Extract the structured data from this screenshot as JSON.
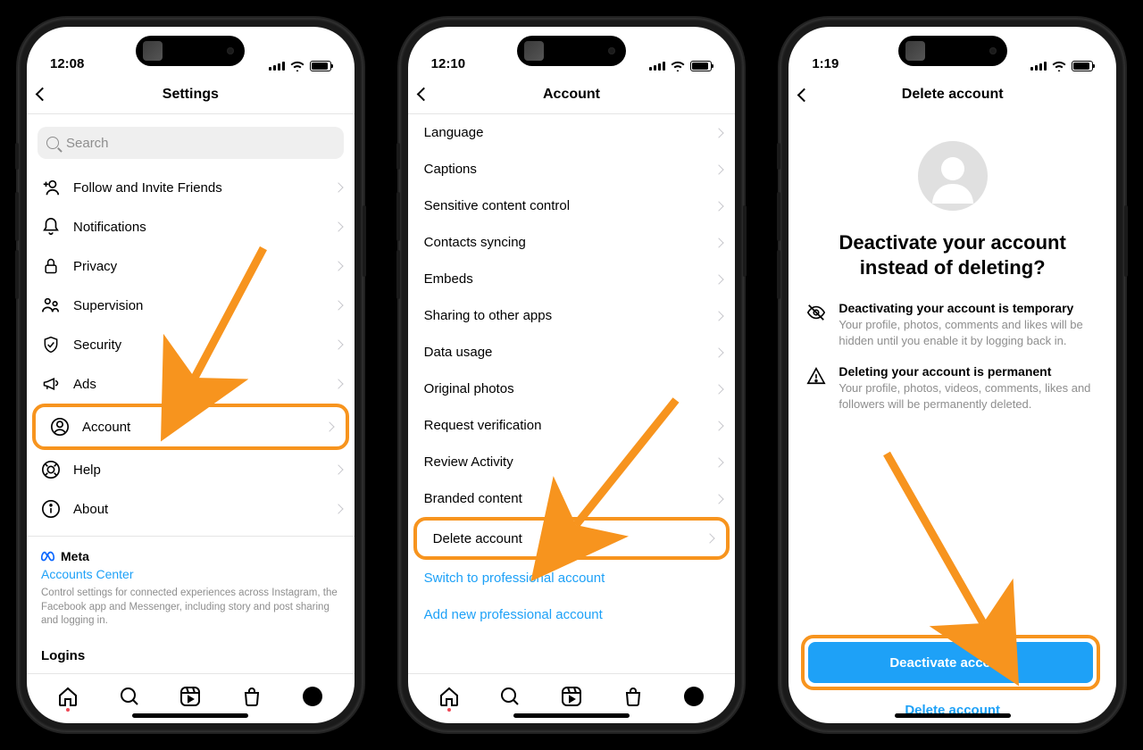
{
  "phone1": {
    "time": "12:08",
    "nav_title": "Settings",
    "search_placeholder": "Search",
    "items": [
      {
        "label": "Follow and Invite Friends"
      },
      {
        "label": "Notifications"
      },
      {
        "label": "Privacy"
      },
      {
        "label": "Supervision"
      },
      {
        "label": "Security"
      },
      {
        "label": "Ads"
      },
      {
        "label": "Account"
      },
      {
        "label": "Help"
      },
      {
        "label": "About"
      }
    ],
    "meta_brand": "Meta",
    "meta_link": "Accounts Center",
    "meta_text": "Control settings for connected experiences across Instagram, the Facebook app and Messenger, including story and post sharing and logging in.",
    "logins": "Logins"
  },
  "phone2": {
    "time": "12:10",
    "nav_title": "Account",
    "items": [
      {
        "label": "Language"
      },
      {
        "label": "Captions"
      },
      {
        "label": "Sensitive content control"
      },
      {
        "label": "Contacts syncing"
      },
      {
        "label": "Embeds"
      },
      {
        "label": "Sharing to other apps"
      },
      {
        "label": "Data usage"
      },
      {
        "label": "Original photos"
      },
      {
        "label": "Request verification"
      },
      {
        "label": "Review Activity"
      },
      {
        "label": "Branded content"
      },
      {
        "label": "Delete account"
      }
    ],
    "links": [
      "Switch to professional account",
      "Add new professional account"
    ]
  },
  "phone3": {
    "time": "1:19",
    "nav_title": "Delete account",
    "title": "Deactivate your account instead of deleting?",
    "info1_head": "Deactivating your account is temporary",
    "info1_sub": "Your profile, photos, comments and likes will be hidden until you enable it by logging back in.",
    "info2_head": "Deleting your account is permanent",
    "info2_sub": "Your profile, photos, videos, comments, likes and followers will be permanently deleted.",
    "primary_btn": "Deactivate account",
    "secondary_btn": "Delete account"
  },
  "annotation_color": "#F7941E"
}
